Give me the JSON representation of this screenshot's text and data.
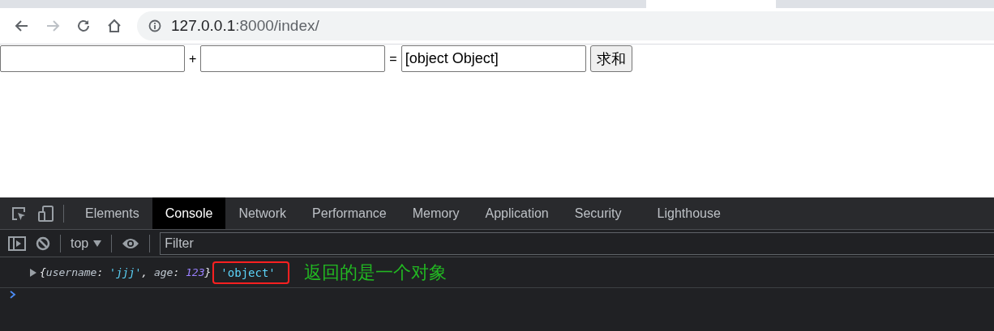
{
  "browser": {
    "forward_disabled": true,
    "address": {
      "host": "127.0.0.1",
      "path": ":8000/index/"
    }
  },
  "form": {
    "plus": "+",
    "equals": "=",
    "result": "[object Object]",
    "button": "求和"
  },
  "devtools": {
    "tabs": [
      {
        "label": "Elements",
        "selected": false
      },
      {
        "label": "Console",
        "selected": true
      },
      {
        "label": "Network",
        "selected": false
      },
      {
        "label": "Performance",
        "selected": false
      },
      {
        "label": "Memory",
        "selected": false
      },
      {
        "label": "Application",
        "selected": false
      },
      {
        "label": "Security",
        "selected": false
      },
      {
        "label": "Lighthouse",
        "selected": false
      }
    ],
    "context": "top",
    "filter_placeholder": "Filter",
    "console": {
      "expanded": false,
      "tokens": [
        {
          "kind": "punct",
          "text": "{"
        },
        {
          "kind": "key",
          "text": "username"
        },
        {
          "kind": "punct",
          "text": ": "
        },
        {
          "kind": "string",
          "text": "'jjj'"
        },
        {
          "kind": "punct",
          "text": ", "
        },
        {
          "kind": "key",
          "text": "age"
        },
        {
          "kind": "punct",
          "text": ": "
        },
        {
          "kind": "number",
          "text": "123"
        },
        {
          "kind": "punct",
          "text": "}"
        }
      ],
      "result": "'object'",
      "result_highlighted": true,
      "annotation": "返回的是一个对象"
    }
  }
}
